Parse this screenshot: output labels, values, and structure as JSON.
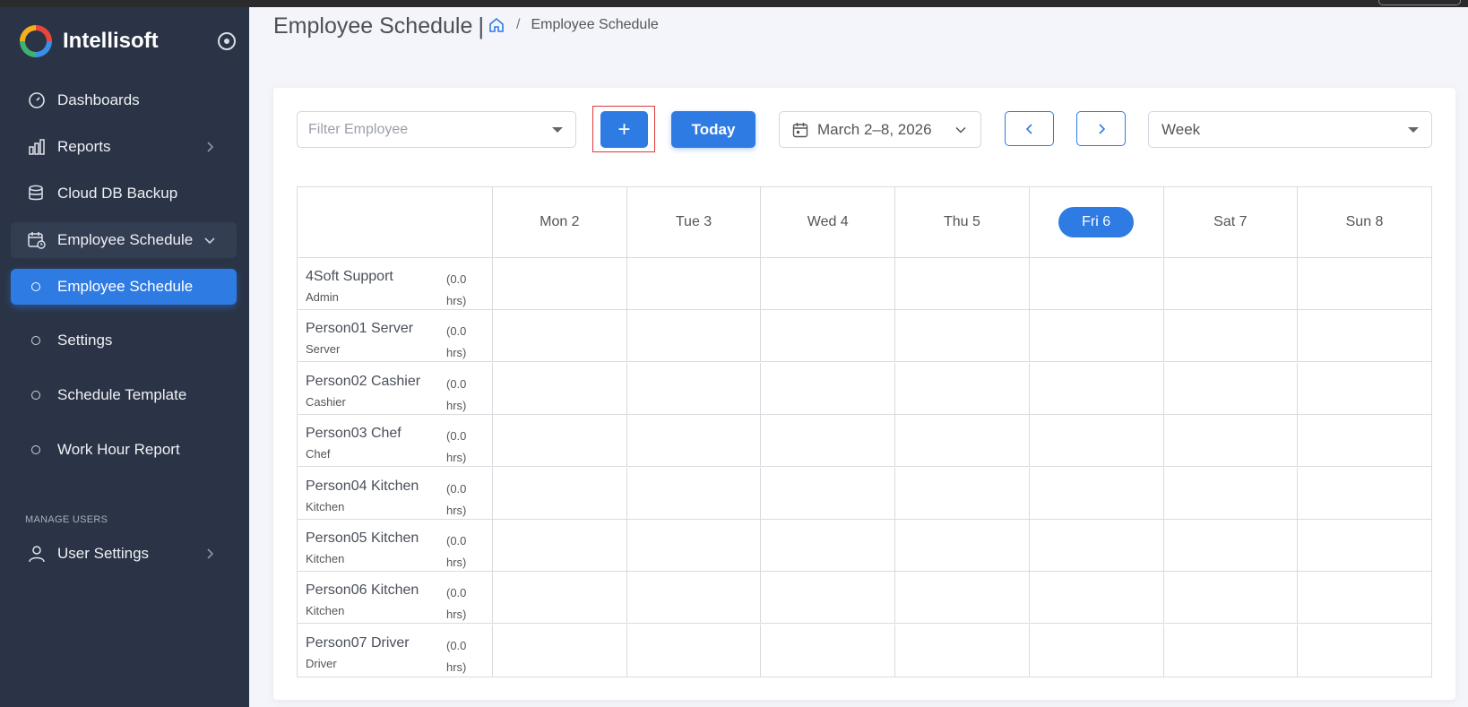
{
  "sidebar": {
    "brand": "Intellisoft",
    "items": [
      {
        "label": "Dashboards"
      },
      {
        "label": "Reports"
      },
      {
        "label": "Cloud DB Backup"
      },
      {
        "label": "Employee Schedule"
      }
    ],
    "subitems": [
      {
        "label": "Employee Schedule",
        "active": true
      },
      {
        "label": "Settings"
      },
      {
        "label": "Schedule Template"
      },
      {
        "label": "Work Hour Report"
      }
    ],
    "section_manage": "MANAGE USERS",
    "user_settings": "User Settings"
  },
  "header": {
    "title": "Employee Schedule",
    "separator": "|",
    "breadcrumb_sep": "/",
    "breadcrumb_current": "Employee Schedule"
  },
  "toolbar": {
    "filter_placeholder": "Filter Employee",
    "add_label": "+",
    "today_label": "Today",
    "date_range": "March 2–8, 2026",
    "view": "Week"
  },
  "schedule": {
    "days": [
      "Mon 2",
      "Tue 3",
      "Wed 4",
      "Thu 5",
      "Fri 6",
      "Sat 7",
      "Sun 8"
    ],
    "today_index": 4,
    "hours_line1": "(0.0",
    "hours_line2": "hrs)",
    "employees": [
      {
        "name": "4Soft Support",
        "role": "Admin"
      },
      {
        "name": "Person01 Server",
        "role": "Server"
      },
      {
        "name": "Person02 Cashier",
        "role": "Cashier"
      },
      {
        "name": "Person03 Chef",
        "role": "Chef"
      },
      {
        "name": "Person04 Kitchen",
        "role": "Kitchen"
      },
      {
        "name": "Person05 Kitchen",
        "role": "Kitchen"
      },
      {
        "name": "Person06 Kitchen",
        "role": "Kitchen"
      },
      {
        "name": "Person07 Driver",
        "role": "Driver"
      }
    ]
  },
  "colors": {
    "accent": "#2f7be4",
    "sidebar_bg": "#2b3446",
    "highlight_border": "#e03a3a"
  }
}
